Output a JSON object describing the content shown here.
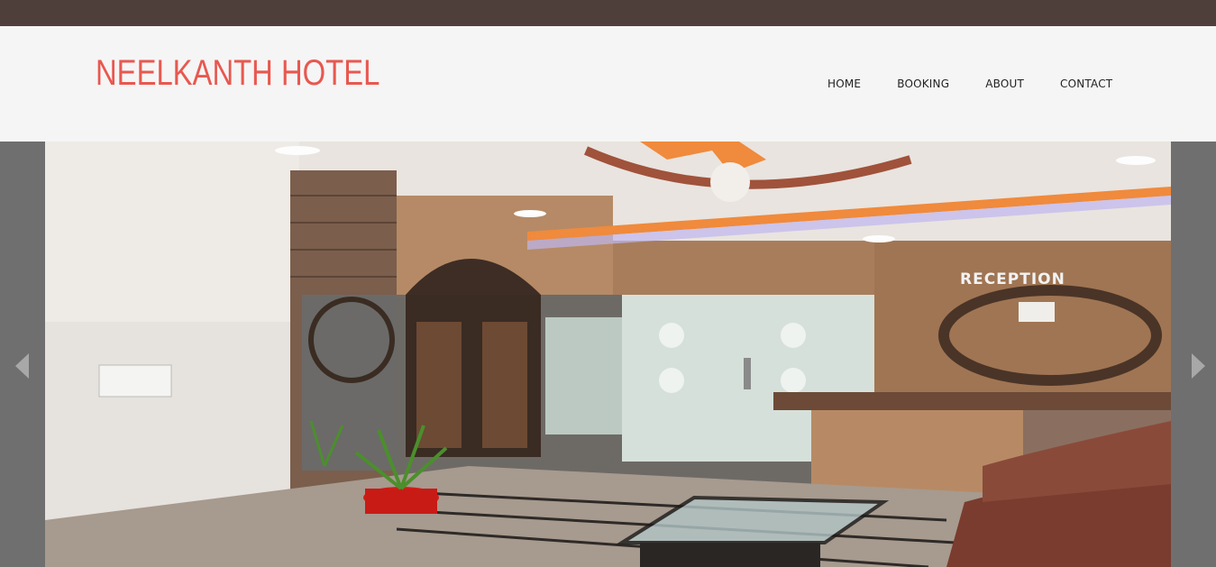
{
  "brand": {
    "title": "NEELKANTH HOTEL",
    "color": "#e8584f"
  },
  "nav": {
    "items": [
      {
        "label": "HOME"
      },
      {
        "label": "BOOKING"
      },
      {
        "label": "ABOUT"
      },
      {
        "label": "CONTACT"
      }
    ]
  },
  "slider": {
    "image_description_icon": "hotel-reception-photo",
    "sign_text": "RECEPTION",
    "prev_icon": "triangle-left-icon",
    "next_icon": "triangle-right-icon"
  },
  "colors": {
    "topbar": "#4f3f3a",
    "header_bg": "#f5f5f5",
    "accent": "#e8584f"
  }
}
